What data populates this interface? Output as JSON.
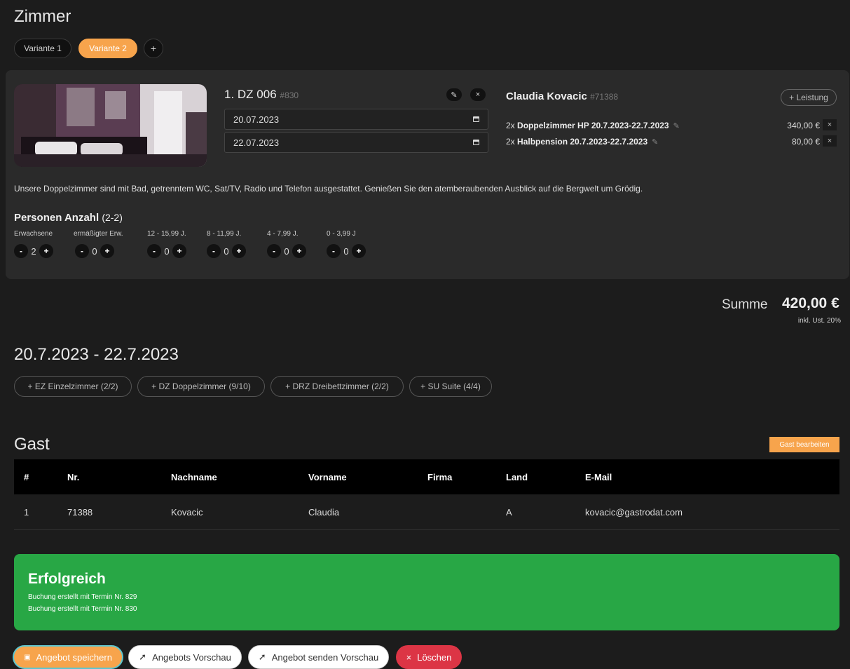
{
  "section_title": "Zimmer",
  "variants": [
    {
      "label": "Variante 1"
    },
    {
      "label": "Variante 2"
    }
  ],
  "add_variant_label": "+",
  "room": {
    "name": "1. DZ 006",
    "ref": "#830",
    "edit_icon": "edit-icon",
    "close_icon": "close-icon",
    "date_from": "20.07.2023",
    "date_to": "22.07.2023",
    "description": "Unsere Doppelzimmer sind mit Bad, getrenntem WC, Sat/TV, Radio und Telefon ausgestattet. Genießen Sie den atemberaubenden Ausblick auf die Bergwelt um Grödig."
  },
  "guest_header": {
    "name": "Claudia Kovacic",
    "ref": "#71388",
    "add_service_label": "+ Leistung"
  },
  "services": [
    {
      "qty": "2x",
      "name": "Doppelzimmer HP 20.7.2023-22.7.2023",
      "price": "340,00 €"
    },
    {
      "qty": "2x",
      "name": "Halbpension 20.7.2023-22.7.2023",
      "price": "80,00 €"
    }
  ],
  "persons": {
    "title": "Personen Anzahl",
    "range": "(2-2)",
    "groups": [
      {
        "label": "Erwachsene",
        "value": "2"
      },
      {
        "label": "ermäßigter Erw.",
        "value": "0"
      },
      {
        "label": "12 - 15,99 J.",
        "value": "0"
      },
      {
        "label": "8 - 11,99 J.",
        "value": "0"
      },
      {
        "label": "4 - 7,99 J.",
        "value": "0"
      },
      {
        "label": "0 - 3,99 J",
        "value": "0"
      }
    ],
    "minus": "-",
    "plus": "+"
  },
  "summary": {
    "label": "Summe",
    "value": "420,00 €",
    "tax_note": "inkl. Ust. 20%"
  },
  "date_range": "20.7.2023 - 22.7.2023",
  "room_categories": [
    {
      "label": "+ EZ Einzelzimmer (2/2)"
    },
    {
      "label": "+ DZ Doppelzimmer (9/10)"
    },
    {
      "label": "+ DRZ Dreibettzimmer (2/2)"
    },
    {
      "label": "+ SU Suite (4/4)"
    }
  ],
  "guest_section": {
    "title": "Gast",
    "edit_label": "Gast bearbeiten",
    "columns": [
      "#",
      "Nr.",
      "Nachname",
      "Vorname",
      "Firma",
      "Land",
      "E-Mail"
    ],
    "rows": [
      [
        "1",
        "71388",
        "Kovacic",
        "Claudia",
        "",
        "A",
        "kovacic@gastrodat.com"
      ]
    ]
  },
  "success": {
    "title": "Erfolgreich",
    "lines": [
      "Buchung erstellt mit Termin Nr. 829",
      "Buchung erstellt mit Termin Nr. 830"
    ]
  },
  "actions": {
    "save": "Angebot speichern",
    "preview": "Angebots Vorschau",
    "send_preview": "Angebot senden Vorschau",
    "delete": "Löschen"
  },
  "colors": {
    "accent": "#f7a44c",
    "success": "#28a745",
    "danger": "#dc3545",
    "email": "#3bbf8c"
  }
}
